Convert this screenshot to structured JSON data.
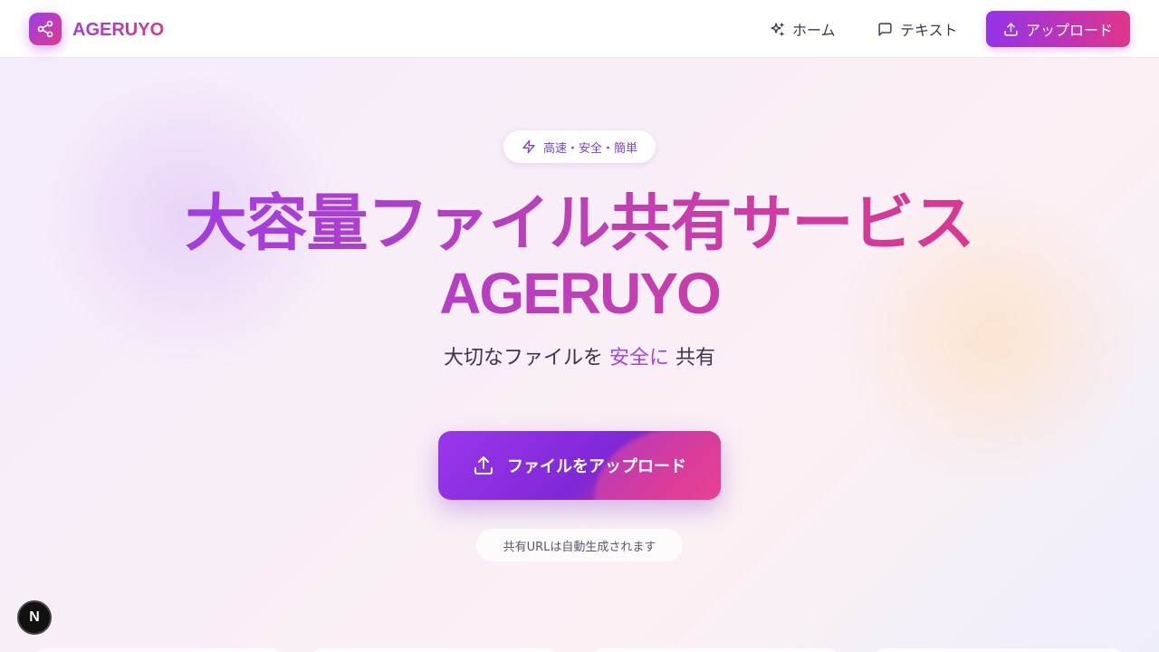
{
  "app": {
    "brand": "AGERUYO"
  },
  "header": {
    "nav": [
      {
        "label": "ホーム",
        "icon": "sparkles-icon"
      },
      {
        "label": "テキスト",
        "icon": "message-square-icon"
      }
    ],
    "upload_button": {
      "label": "アップロード",
      "icon": "upload-icon"
    }
  },
  "hero": {
    "badge": "高速・安全・簡単",
    "title_line1": "大容量ファイル共有サービス",
    "title_line2": "AGERUYO",
    "subtitle_before": "大切なファイルを",
    "subtitle_accent": "安全に",
    "subtitle_after": "共有",
    "cta_label": "ファイルをアップロード",
    "note": "共有URLは自動生成されます"
  },
  "dev_badge": "N",
  "colors": {
    "brand_purple": "#9333ea",
    "brand_pink": "#e0358a",
    "accent_text": "#a245e6",
    "body_text": "#3b3550"
  }
}
